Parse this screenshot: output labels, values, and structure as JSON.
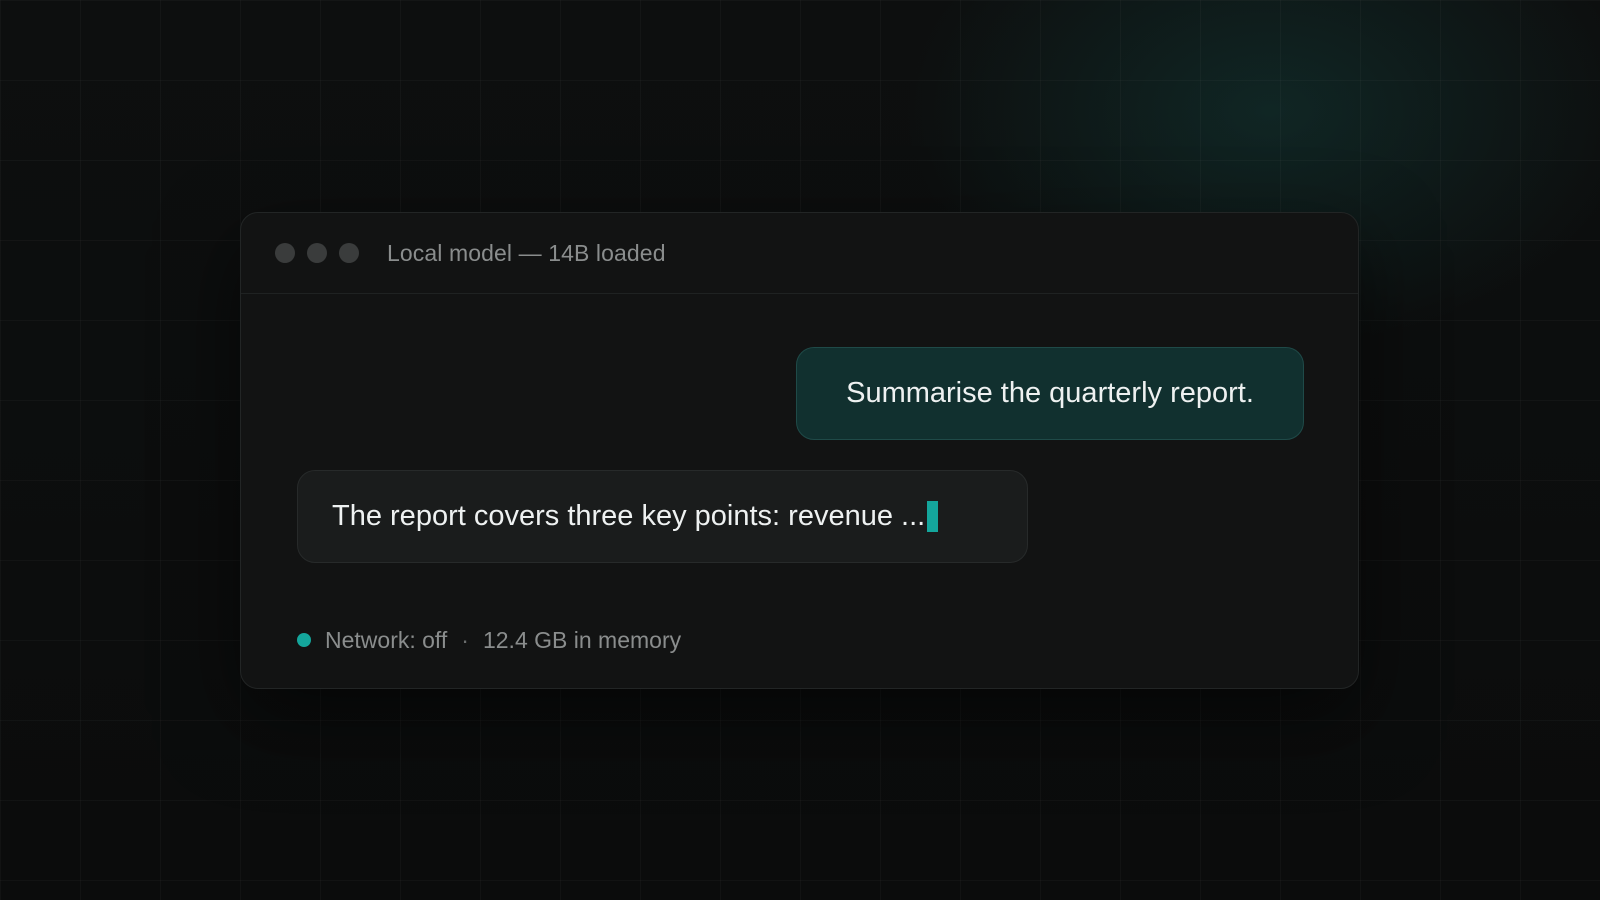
{
  "window": {
    "title": "Local model — 14B loaded"
  },
  "chat": {
    "user_message": "Summarise the quarterly report.",
    "assistant_message": "The report covers three key points: revenue ..."
  },
  "status": {
    "network": "Network: off",
    "separator": "·",
    "memory": "12.4 GB in memory"
  },
  "colors": {
    "accent": "#14a69c"
  },
  "icons": {
    "window_controls": [
      "close-dot-icon",
      "minimize-dot-icon",
      "maximize-dot-icon"
    ],
    "status": "status-dot-icon",
    "cursor": "text-cursor-icon"
  }
}
